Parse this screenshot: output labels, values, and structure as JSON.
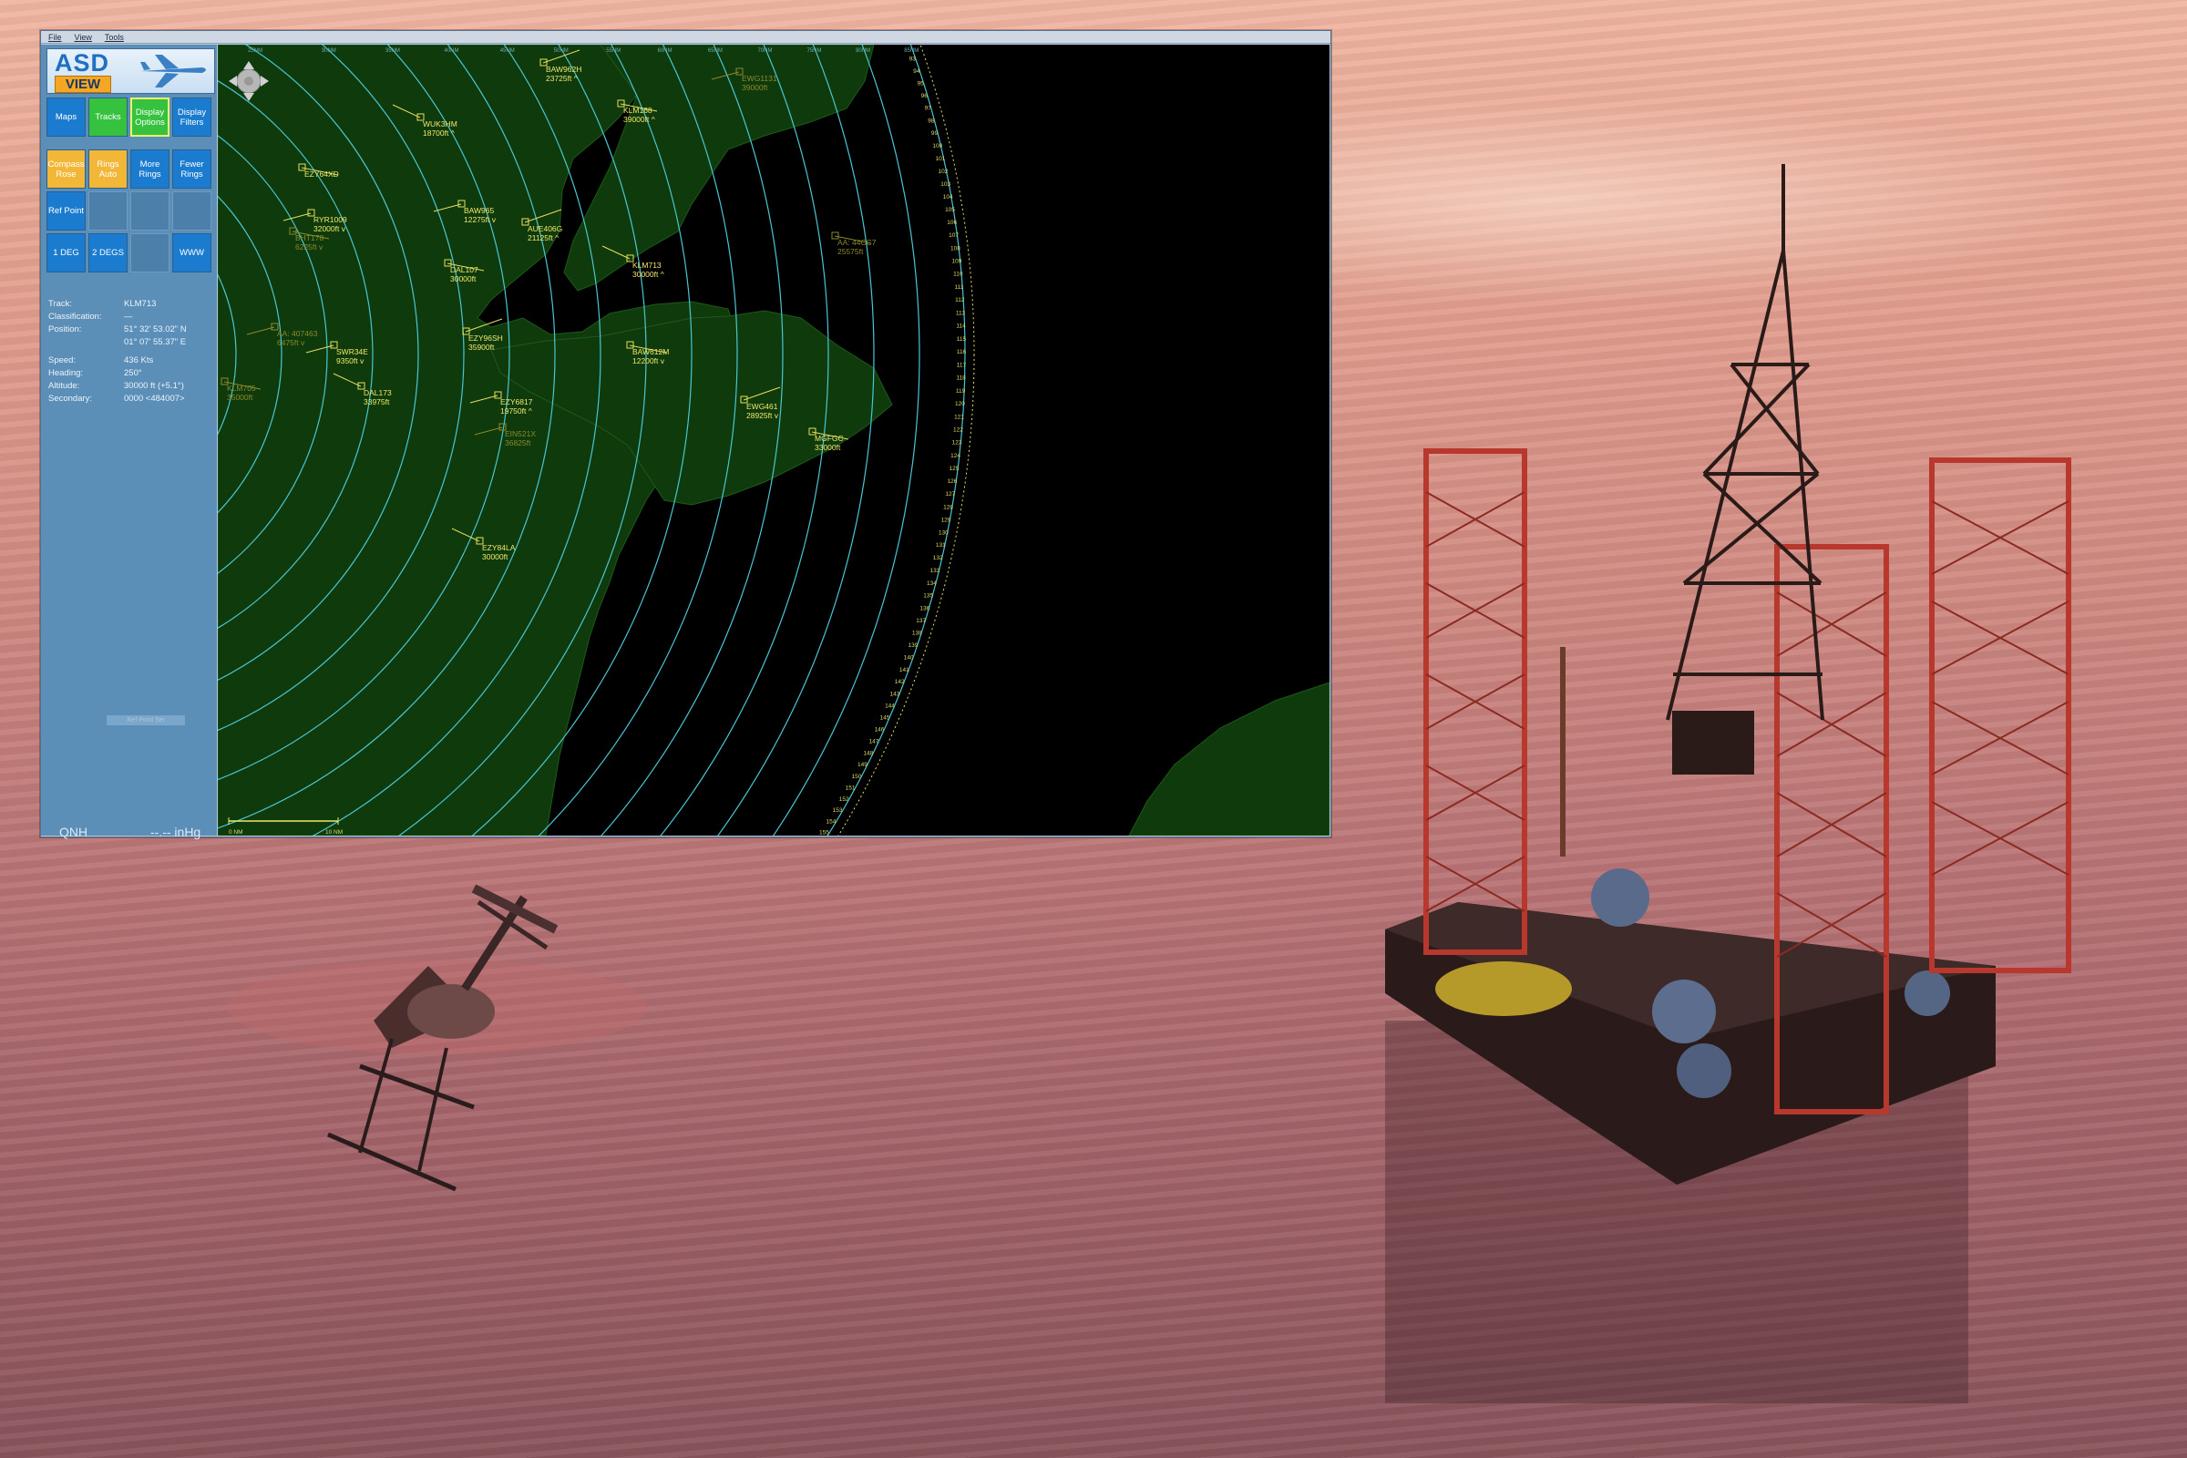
{
  "menu": [
    "File",
    "View",
    "Tools"
  ],
  "logo": {
    "title": "ASD",
    "subtitle": "VIEW"
  },
  "buttons_row1": [
    {
      "label": "Maps",
      "style": "blue"
    },
    {
      "label": "Tracks",
      "style": "green"
    },
    {
      "label": "Display Options",
      "style": "green-on"
    },
    {
      "label": "Display Filters",
      "style": "blue"
    }
  ],
  "buttons_row2": [
    {
      "label": "Compass Rose",
      "style": "yellow"
    },
    {
      "label": "Rings Auto",
      "style": "yellow"
    },
    {
      "label": "More Rings",
      "style": "blue"
    },
    {
      "label": "Fewer Rings",
      "style": "blue"
    }
  ],
  "buttons_row3": [
    {
      "label": "Ref Point",
      "style": "blue"
    },
    {
      "label": "",
      "style": "empty"
    },
    {
      "label": "",
      "style": "empty"
    },
    {
      "label": "",
      "style": "empty"
    }
  ],
  "buttons_row4": [
    {
      "label": "1 DEG",
      "style": "blue"
    },
    {
      "label": "2 DEGS",
      "style": "blue"
    },
    {
      "label": "",
      "style": "empty"
    },
    {
      "label": "WWW",
      "style": "blue"
    }
  ],
  "info": {
    "track_label": "Track:",
    "track": "KLM713",
    "class_label": "Classification:",
    "class": "—",
    "pos_label": "Position:",
    "pos_lat": "51° 32' 53.02\" N",
    "pos_lon": "01° 07' 55.37\" E",
    "speed_label": "Speed:",
    "speed": "436 Kts",
    "heading_label": "Heading:",
    "heading": "250°",
    "alt_label": "Altitude:",
    "alt": "30000 ft (+5.1°)",
    "sec_label": "Secondary:",
    "sec": "0000 <484007>"
  },
  "ref_button": "Ref Point Set",
  "qnh_label": "QNH",
  "qnh_value": "--.-- inHg",
  "colors": {
    "land": "#0f3a0c",
    "sea": "#000000",
    "rings": "#49c6d4",
    "tracks": "#e6de5c",
    "sidebar": "#5c8fb8"
  },
  "tracks": [
    {
      "cs": "BAW962H",
      "alt": "23725ft ^",
      "dim": false
    },
    {
      "cs": "EWG1131",
      "alt": "39000ft",
      "dim": true
    },
    {
      "cs": "KLM168",
      "alt": "39000ft ^",
      "dim": false
    },
    {
      "cs": "WUK3HM",
      "alt": "18700ft ^",
      "dim": false
    },
    {
      "cs": "EZY64XD",
      "alt": "",
      "dim": false
    },
    {
      "cs": "BAW965",
      "alt": "12275ft v",
      "dim": false
    },
    {
      "cs": "AUE406G",
      "alt": "21125ft ^",
      "dim": false
    },
    {
      "cs": "RYR1009",
      "alt": "32000ft v",
      "dim": false
    },
    {
      "cs": "DAL107",
      "alt": "30000ft",
      "dim": false
    },
    {
      "cs": "KLM713",
      "alt": "30000ft ^",
      "dim": false
    },
    {
      "cs": "AA: 44CC7",
      "alt": "25575ft",
      "dim": true
    },
    {
      "cs": "AA: 407463",
      "alt": "6475ft v",
      "dim": true
    },
    {
      "cs": "EZY96SH",
      "alt": "35900ft",
      "dim": false
    },
    {
      "cs": "SWR34E",
      "alt": "9350ft v",
      "dim": false
    },
    {
      "cs": "BAW612M",
      "alt": "12200ft v",
      "dim": false
    },
    {
      "cs": "DAL173",
      "alt": "33975ft",
      "dim": false
    },
    {
      "cs": "KLM705",
      "alt": "35000ft",
      "dim": true
    },
    {
      "cs": "EZY6817",
      "alt": "19750ft ^",
      "dim": false
    },
    {
      "cs": "EWG461",
      "alt": "28925ft v",
      "dim": false
    },
    {
      "cs": "EIN521X",
      "alt": "36825ft",
      "dim": true
    },
    {
      "cs": "MGFGC",
      "alt": "33000ft",
      "dim": false
    },
    {
      "cs": "EZY84LA",
      "alt": "30000ft",
      "dim": false
    },
    {
      "cs": "BHT178",
      "alt": "6225ft v",
      "dim": true
    }
  ],
  "ring_labels": [
    "5NM",
    "10NM",
    "15NM",
    "20NM",
    "25NM",
    "30NM",
    "35NM",
    "40NM",
    "45NM",
    "50NM",
    "55NM",
    "60NM",
    "65NM",
    "70NM",
    "75NM",
    "80NM",
    "85NM"
  ],
  "scale": {
    "left": "0 NM",
    "right": "10 NM"
  },
  "tick_numbers": [
    93,
    94,
    95,
    96,
    97,
    98,
    99,
    100,
    101,
    102,
    103,
    104,
    105,
    106,
    107,
    108,
    109,
    110,
    111,
    112,
    113,
    114,
    115,
    116,
    117,
    118,
    119,
    120,
    121,
    122,
    123,
    124,
    125,
    126,
    127,
    128,
    129,
    130,
    131,
    132,
    133,
    134,
    135,
    136,
    137,
    138,
    139,
    140,
    141,
    142,
    143,
    144,
    145,
    146,
    147,
    148,
    149,
    150,
    151,
    152,
    153,
    154,
    155,
    156,
    157,
    158
  ]
}
